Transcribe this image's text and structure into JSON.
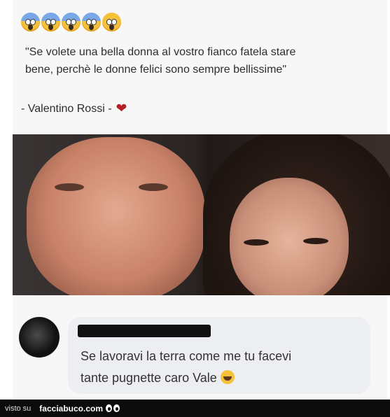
{
  "post": {
    "quote_text": "\"Se volete una bella donna al vostro fianco fatela stare\nbene, perchè le donne felici sono sempre bellissime\"",
    "author": "- Valentino Rossi -",
    "emoji_icons": [
      "scream-emoji-icon",
      "scream-emoji-icon",
      "scream-emoji-icon",
      "scream-emoji-icon",
      "flushed-emoji-icon"
    ]
  },
  "comment": {
    "text": "Se lavoravi la terra come me tu facevi\ntante pugnette caro Vale"
  },
  "footer": {
    "visto_su": "visto su",
    "site": "facciabuco.com"
  },
  "colors": {
    "heart": "#b32227",
    "footer_bg": "#0b0b0b"
  }
}
